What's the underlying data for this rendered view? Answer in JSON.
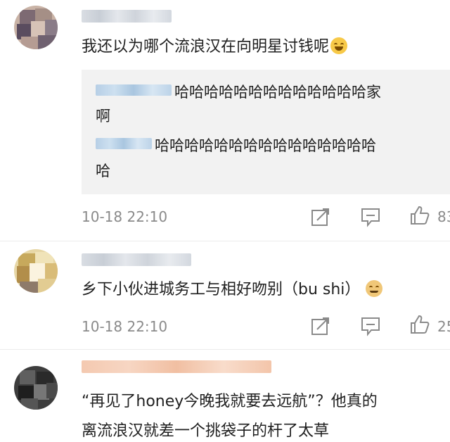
{
  "comments": [
    {
      "text": "我还以为哪个流浪汉在向明星讨钱呢",
      "emoji": "laughing-tears-emoji",
      "replies": [
        {
          "line1": "哈哈哈哈哈哈哈哈哈哈哈哈哈家",
          "line2": "啊"
        },
        {
          "line1": "哈哈哈哈哈哈哈哈哈哈哈哈哈哈哈",
          "line2": "哈"
        }
      ],
      "timestamp": "10-18 22:10",
      "likes": "83"
    },
    {
      "text": "乡下小伙进城务工与相好吻别（bu shi）",
      "emoji": "doge-emoji",
      "timestamp": "10-18 22:10",
      "likes": "25"
    },
    {
      "text_line1": "“再见了honey今晚我就要去远航”？他真的",
      "text_line2": "离流浪汉就差一个挑袋子的杆了太草"
    }
  ],
  "icons": {
    "share": "share-icon",
    "comment": "comment-icon",
    "like": "thumbs-up-icon"
  },
  "colors": {
    "meta_text": "#8a8a8a",
    "reply_background": "#f2f2f2",
    "icon_stroke": "#8a8a8a"
  }
}
